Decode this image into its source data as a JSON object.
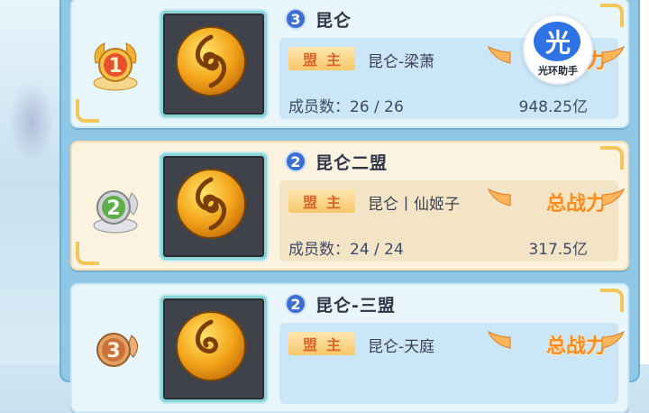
{
  "labels": {
    "leader": "盟主",
    "members_prefix": "成员数："
  },
  "guilds": [
    {
      "rank": "1",
      "level": "3",
      "name": "昆仑",
      "leader": "昆仑-梁萧",
      "members": "26 / 26",
      "power_label": "总战力",
      "power_value": "948.25亿"
    },
    {
      "rank": "2",
      "level": "2",
      "name": "昆仑二盟",
      "leader": "昆仑丨仙姬子",
      "members": "24 / 24",
      "power_label": "总战力",
      "power_value": "317.5亿"
    },
    {
      "rank": "3",
      "level": "2",
      "name": "昆仑-三盟",
      "leader": "昆仑-天庭",
      "members": "",
      "power_label": "总战力",
      "power_value": ""
    }
  ],
  "watermark": {
    "glyph": "光",
    "text": "光环助手"
  },
  "colors": {
    "medal_gold": "#f2b233",
    "medal_silver": "#c6c7c9",
    "medal_bronze": "#d08c4a",
    "level_badge": "#3d6fd0",
    "power_orange": "#ff8a22"
  }
}
